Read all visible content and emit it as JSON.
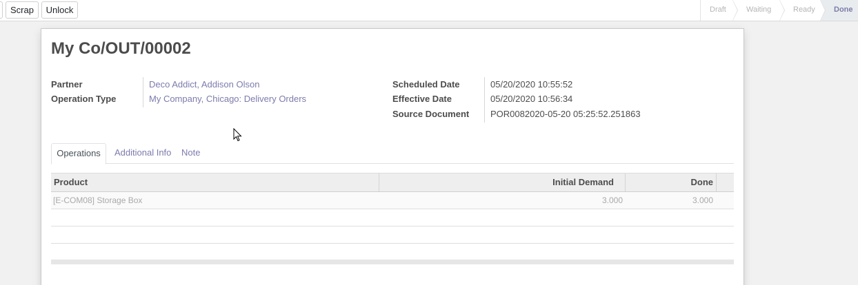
{
  "control_bar": {
    "scrap_label": "Scrap",
    "unlock_label": "Unlock"
  },
  "statusbar": {
    "stages": [
      "Draft",
      "Waiting",
      "Ready",
      "Done"
    ],
    "current": "Done"
  },
  "record": {
    "title": "My Co/OUT/00002",
    "partner_label": "Partner",
    "partner_value": "Deco Addict, Addison Olson",
    "operation_type_label": "Operation Type",
    "operation_type_value": "My Company, Chicago: Delivery Orders",
    "scheduled_date_label": "Scheduled Date",
    "scheduled_date_value": "05/20/2020 10:55:52",
    "effective_date_label": "Effective Date",
    "effective_date_value": "05/20/2020 10:56:34",
    "source_document_label": "Source Document",
    "source_document_value": "POR0082020-05-20 05:25:52.251863"
  },
  "tabs": {
    "operations": "Operations",
    "additional_info": "Additional Info",
    "note": "Note",
    "active": "Operations"
  },
  "table": {
    "headers": {
      "product": "Product",
      "initial_demand": "Initial Demand",
      "done": "Done"
    },
    "rows": [
      {
        "product": "[E-COM08] Storage Box",
        "initial_demand": "3.000",
        "done": "3.000"
      }
    ]
  },
  "colors": {
    "link": "#7c7bad",
    "current_stage_bg": "#e9ecef",
    "current_stage_text": "#7b7ea6"
  },
  "icons": [
    "mouse-pointer-icon"
  ]
}
